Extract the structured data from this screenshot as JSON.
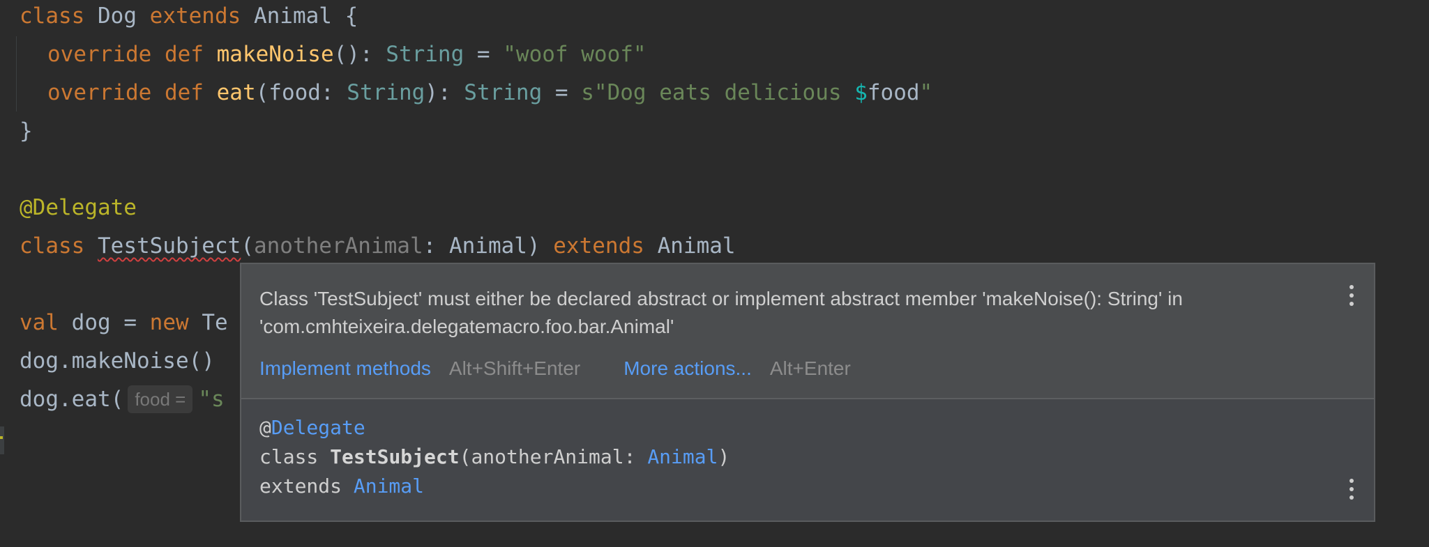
{
  "code": {
    "line1": {
      "kw": "class",
      "name": " Dog ",
      "kw2": "extends",
      "rest": " Animal {"
    },
    "line2": {
      "kw": "override",
      "kw2": " def ",
      "fn": "makeNoise",
      "punct": "(): ",
      "type": "String",
      "eq": " = ",
      "str": "\"woof woof\""
    },
    "line3": {
      "kw": "override",
      "kw2": " def ",
      "fn": "eat",
      "p1": "(food: ",
      "type1": "String",
      "p2": "): ",
      "type2": "String",
      "eq": " = ",
      "str": "s\"Dog eats delicious ",
      "dollar": "$",
      "var": "food",
      "quote": "\""
    },
    "line4": "}",
    "line5": "@Delegate",
    "line6": {
      "kw": "class",
      "sp": " ",
      "name": "TestSubject",
      "open": "(",
      "param": "anotherAnimal",
      "mid": ": Animal) ",
      "kw2": "extends",
      "rest": " Animal"
    },
    "line7": {
      "kw": "val",
      "mid": " dog = ",
      "kw2": "new",
      "rest": " Te"
    },
    "line8": "dog.makeNoise()",
    "line9": {
      "call": "dog.eat(",
      "inlay": "food =",
      "str": "\"s"
    }
  },
  "popup": {
    "message": "Class 'TestSubject' must either be declared abstract or implement abstract member 'makeNoise(): String' in 'com.cmhteixeira.delegatemacro.foo.bar.Animal'",
    "action1_label": "Implement methods",
    "action1_shortcut": "Alt+Shift+Enter",
    "action2_label": "More actions...",
    "action2_shortcut": "Alt+Enter",
    "doc": {
      "at": "@",
      "annotation": "Delegate",
      "kw": "class ",
      "name": "TestSubject",
      "open": "(anotherAnimal: ",
      "type": "Animal",
      "close": ")",
      "kw2": "extends ",
      "type2": "Animal"
    }
  },
  "icons": {
    "more": "kebab-menu-icon"
  },
  "colors": {
    "background": "#2b2b2b",
    "keyword": "#cc7832",
    "function": "#ffc66d",
    "string": "#6a8759",
    "annotation": "#bbb529",
    "link": "#589df6",
    "error": "#d04040"
  }
}
